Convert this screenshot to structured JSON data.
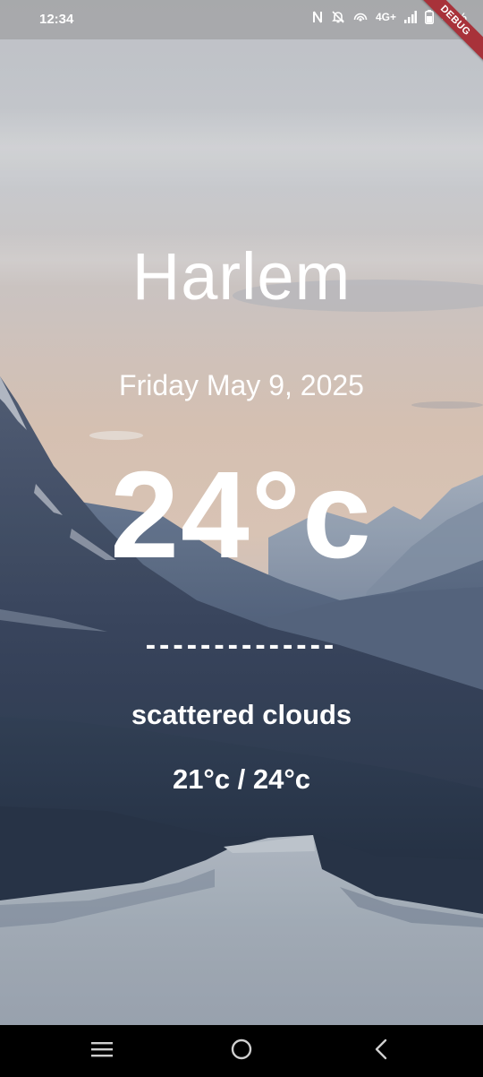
{
  "status_bar": {
    "time": "12:34",
    "network": "4G+",
    "battery": "47%",
    "icons": [
      "nfc-icon",
      "bell-off-icon",
      "hotspot-icon",
      "signal-icon",
      "battery-icon"
    ]
  },
  "debug_banner": {
    "label": "DEBUG"
  },
  "weather": {
    "city": "Harlem",
    "date": "Friday May 9, 2025",
    "temperature": "24°c",
    "divider": "--------------",
    "condition": "scattered clouds",
    "min_max": "21°c / 24°c"
  },
  "nav_bar": {
    "icons": [
      "recents-icon",
      "home-icon",
      "back-icon"
    ]
  },
  "colors": {
    "text": "#ffffff",
    "debug_ribbon": "#a8323a",
    "nav_background": "#000000"
  }
}
